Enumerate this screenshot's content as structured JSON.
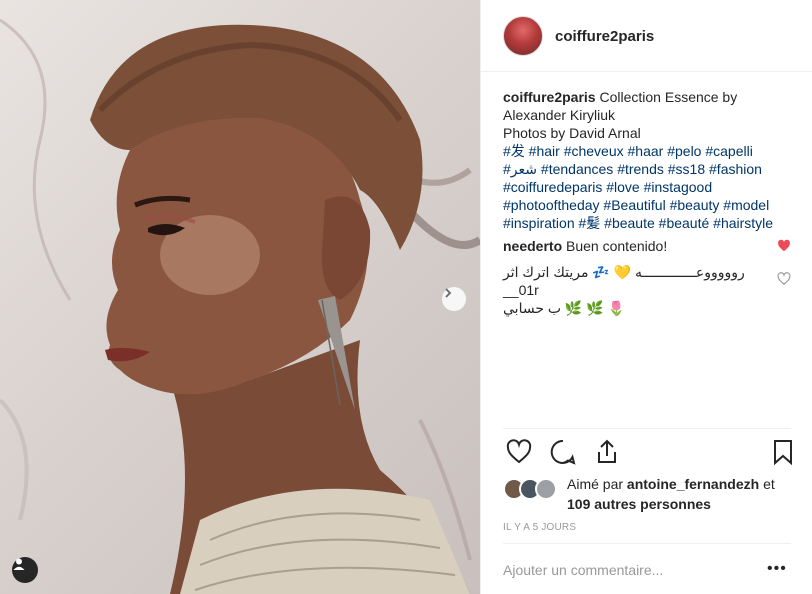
{
  "post": {
    "username": "coiffure2paris"
  },
  "caption": {
    "username": "coiffure2paris",
    "lines": [
      "Collection Essence by Alexander Kiryliuk",
      "Photos by David Arnal"
    ],
    "hashtag_lines": [
      "#发 #hair #cheveux #haar #pelo #capelli",
      "#شعر #tendances #trends #ss18 #fashion",
      "#coiffuredeparis #love #instagood",
      "#photooftheday #Beautiful #beauty #model",
      "#inspiration #髪 #beaute #beauté #hairstyle"
    ]
  },
  "comments": [
    {
      "username": "neederto",
      "text": "Buen contenido!",
      "liked": true
    },
    {
      "username": "",
      "text_line1": "روووووعـــــــــــــه 💛 💤 مريتك اترك اثر 01r__",
      "text_line2": "🌷 🌿 🌿 ب حسابي",
      "liked": false
    }
  ],
  "likes": {
    "prefix": "Aimé par",
    "user": "antoine_fernandezh",
    "suffix": "et",
    "others": "109 autres personnes"
  },
  "timestamp": "IL Y A 5 JOURS",
  "add_comment_placeholder": "Ajouter un commentaire...",
  "more_label": "•••",
  "colors": {
    "text": "#262626",
    "hashtag": "#003569",
    "muted": "#999999",
    "like_red": "#ed4956",
    "divider": "#efefef"
  },
  "icons": [
    "heart-icon",
    "comment-icon",
    "share-icon",
    "bookmark-icon",
    "next-arrow-icon",
    "user-tag-icon"
  ]
}
